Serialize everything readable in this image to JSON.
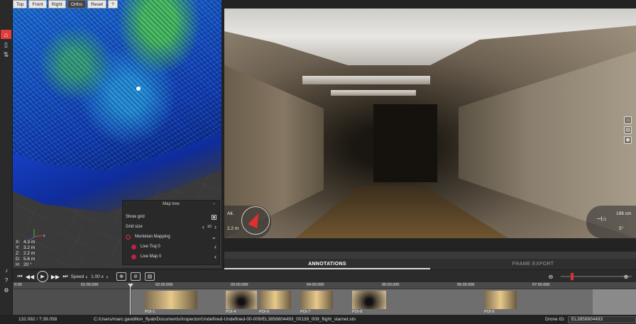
{
  "sidebar": {
    "items": [
      {
        "icon": "home-icon",
        "glyph": "⌂"
      },
      {
        "icon": "document-icon",
        "glyph": "▯"
      },
      {
        "icon": "transform-icon",
        "glyph": "⇅"
      }
    ]
  },
  "viewport": {
    "buttons": [
      "Top",
      "Front",
      "Right",
      "Ortho",
      "Reset",
      "?"
    ],
    "coords": [
      {
        "axis": "X:",
        "value": "4.3 m"
      },
      {
        "axis": "Y:",
        "value": "3.2 m"
      },
      {
        "axis": "Z:",
        "value": "2.2 m"
      },
      {
        "axis": "D:",
        "value": "5.8 m"
      },
      {
        "axis": "H:",
        "value": "20 °"
      }
    ]
  },
  "maptree": {
    "title": "Map tree",
    "collapse_glyph": "–",
    "show_grid_label": "Show grid",
    "grid_size_label": "Grid size",
    "grid_size_value": "10",
    "root_label": "Montetan Mapping",
    "children": [
      {
        "label": "Live Traj 0"
      },
      {
        "label": "Live Map 0"
      }
    ]
  },
  "video": {
    "alt_label": "Alt.",
    "alt_value": "2.2 m",
    "distance_value": "198 cm",
    "heading_value": "5°"
  },
  "tabs": [
    {
      "label": "ANNOTATIONS",
      "active": true
    },
    {
      "label": "FRAME EXPORT",
      "active": false
    }
  ],
  "playback": {
    "speed_label": "Speed",
    "speed_value": "1.00 x"
  },
  "timeline": {
    "ticks": [
      "0:00",
      "01:00.000",
      "02:00.000",
      "03:00.000",
      "04:00.000",
      "05:00.000",
      "06:00.000",
      "07:00.000"
    ],
    "pois": [
      "POI-1",
      "POI-4",
      "POI-6",
      "POI-7",
      "POI-8",
      "POI-9"
    ]
  },
  "status": {
    "time": "132.092 / 7:39.058",
    "path": "C:/Users/marc.gandillon_flyab/Documents/Inspector/Undefined-Undefined-00-009/EL3858804493_00139_009_flight_starnet.stn",
    "drone_id_label": "Drone ID:",
    "drone_id_value": "EL3858804493"
  }
}
